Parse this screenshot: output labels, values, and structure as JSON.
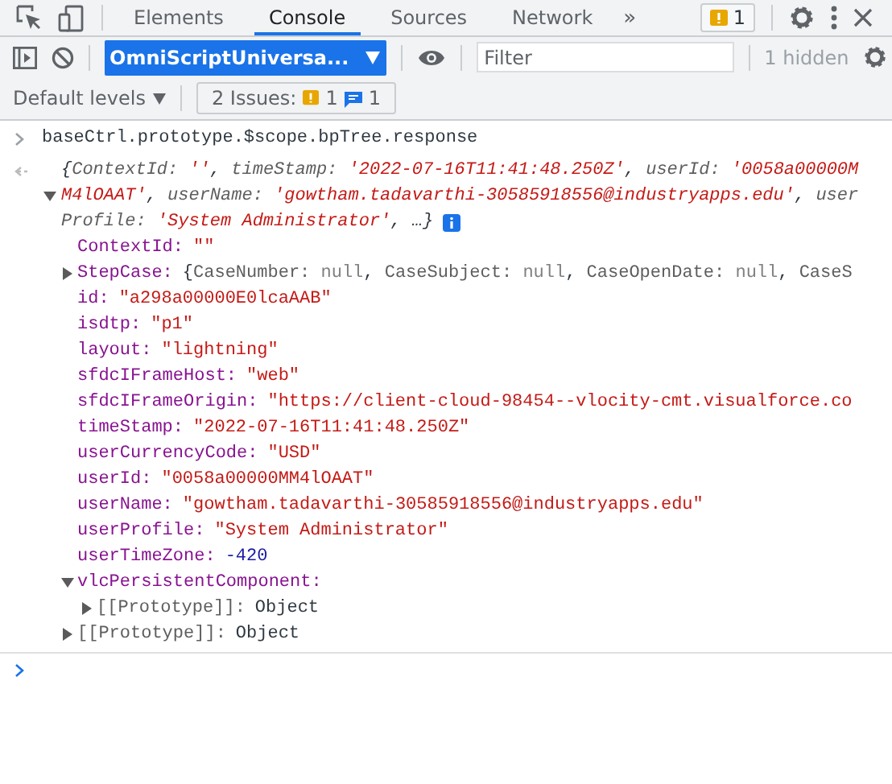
{
  "toolbar": {
    "tabs": [
      {
        "label": "Elements",
        "selected": false
      },
      {
        "label": "Console",
        "selected": true
      },
      {
        "label": "Sources",
        "selected": false
      },
      {
        "label": "Network",
        "selected": false
      }
    ],
    "more": "»",
    "issues_badge": "1"
  },
  "console_bar": {
    "context": "OmniScriptUniversa...",
    "filter": {
      "placeholder": "Filter"
    },
    "hidden_count": "1 hidden"
  },
  "levels_bar": {
    "levels": "Default levels",
    "issues_label": "2 Issues:",
    "warnings": "1",
    "infos": "1"
  },
  "command": "baseCtrl.prototype.$scope.bpTree.response",
  "result": {
    "expanded": true,
    "summary_lines": [
      [
        {
          "kind": "punct",
          "text": "{"
        },
        {
          "kind": "key",
          "text": "ContextId: "
        },
        {
          "kind": "string",
          "text": "''"
        },
        {
          "kind": "punct",
          "text": ", "
        },
        {
          "kind": "key",
          "text": "timeStamp: "
        },
        {
          "kind": "string",
          "text": "'2022-07-16T11:41:48.250Z'"
        },
        {
          "kind": "punct",
          "text": ", "
        },
        {
          "kind": "key",
          "text": "userId: "
        },
        {
          "kind": "string",
          "text": "'0058a00000M"
        }
      ],
      [
        {
          "kind": "string",
          "text": "M4lOAAT'"
        },
        {
          "kind": "punct",
          "text": ", "
        },
        {
          "kind": "key",
          "text": "userName: "
        },
        {
          "kind": "string",
          "text": "'gowtham.tadavarthi-30585918556@industryapps.edu'"
        },
        {
          "kind": "punct",
          "text": ", "
        },
        {
          "kind": "key",
          "text": "user"
        }
      ],
      [
        {
          "kind": "key",
          "text": "Profile: "
        },
        {
          "kind": "string",
          "text": "'System Administrator'"
        },
        {
          "kind": "punct",
          "text": ", …}"
        }
      ]
    ],
    "properties": [
      {
        "key": "ContextId:",
        "kind": "string",
        "value": "\"\""
      },
      {
        "key": "StepCase:",
        "kind": "preview",
        "expanded": false,
        "segments": [
          {
            "kind": "punct",
            "text": "{"
          },
          {
            "kind": "key",
            "text": "CaseNumber: "
          },
          {
            "kind": "null",
            "text": "null"
          },
          {
            "kind": "punct",
            "text": ", "
          },
          {
            "kind": "key",
            "text": "CaseSubject: "
          },
          {
            "kind": "null",
            "text": "null"
          },
          {
            "kind": "punct",
            "text": ", "
          },
          {
            "kind": "key",
            "text": "CaseOpenDate: "
          },
          {
            "kind": "null",
            "text": "null"
          },
          {
            "kind": "punct",
            "text": ", "
          },
          {
            "kind": "key",
            "text": "CaseS"
          }
        ]
      },
      {
        "key": "id:",
        "kind": "string",
        "value": "\"a298a00000E0lcaAAB\""
      },
      {
        "key": "isdtp:",
        "kind": "string",
        "value": "\"p1\""
      },
      {
        "key": "layout:",
        "kind": "string",
        "value": "\"lightning\""
      },
      {
        "key": "sfdcIFrameHost:",
        "kind": "string",
        "value": "\"web\""
      },
      {
        "key": "sfdcIFrameOrigin:",
        "kind": "string",
        "value": "\"https://client-cloud-98454--vlocity-cmt.visualforce.co"
      },
      {
        "key": "timeStamp:",
        "kind": "string",
        "value": "\"2022-07-16T11:41:48.250Z\""
      },
      {
        "key": "userCurrencyCode:",
        "kind": "string",
        "value": "\"USD\""
      },
      {
        "key": "userId:",
        "kind": "string",
        "value": "\"0058a00000MM4lOAAT\""
      },
      {
        "key": "userName:",
        "kind": "string",
        "value": "\"gowtham.tadavarthi-30585918556@industryapps.edu\""
      },
      {
        "key": "userProfile:",
        "kind": "string",
        "value": "\"System Administrator\""
      },
      {
        "key": "userTimeZone:",
        "kind": "number",
        "value": "-420"
      },
      {
        "key": "vlcPersistentComponent:",
        "kind": "object",
        "expanded": true,
        "children": [
          {
            "key": "[[Prototype]]:",
            "kind": "prototype",
            "value": "Object",
            "expanded": false
          }
        ]
      },
      {
        "key": "[[Prototype]]:",
        "kind": "prototype",
        "value": "Object",
        "expanded": false
      }
    ]
  }
}
